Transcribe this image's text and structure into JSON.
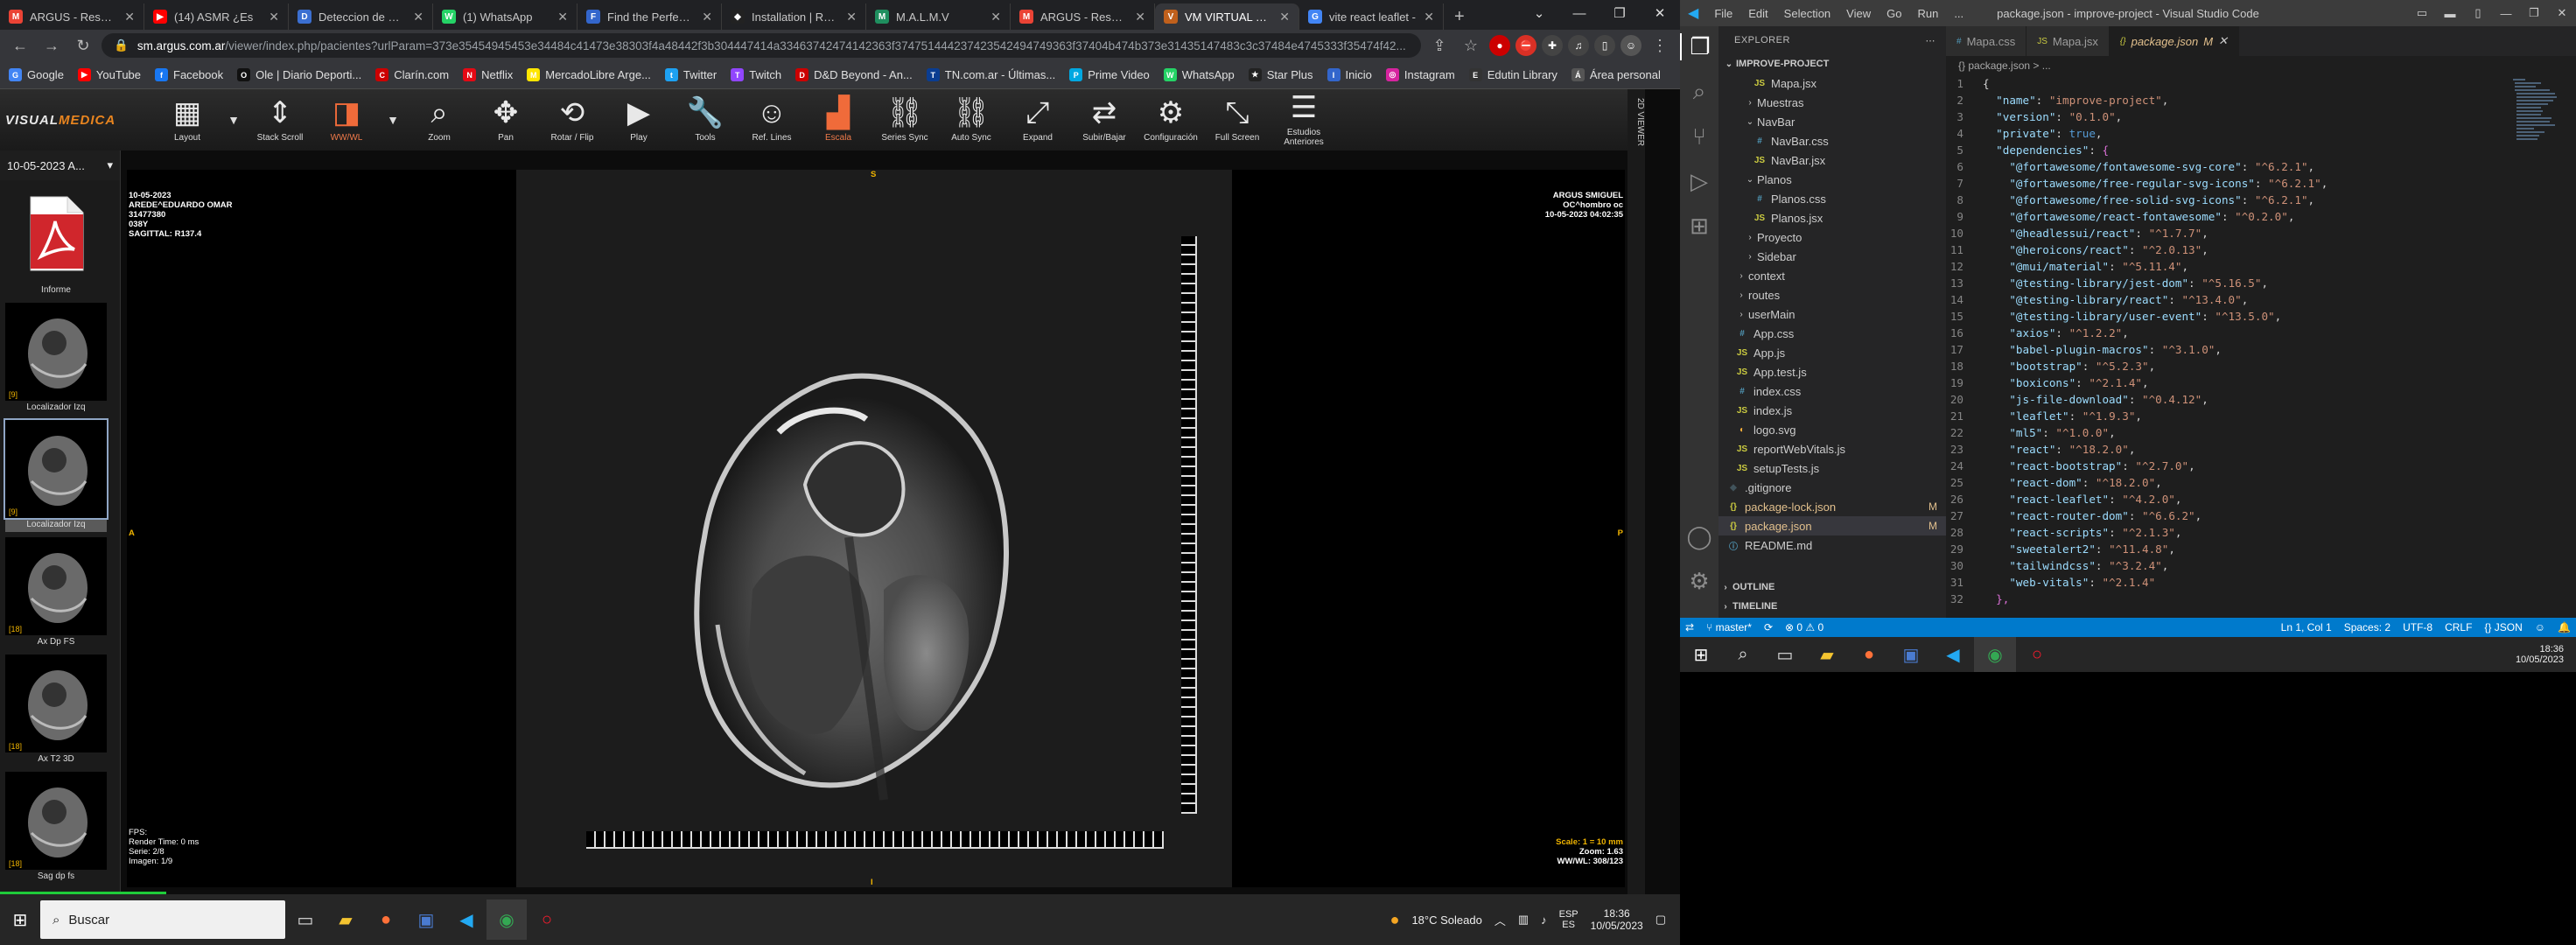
{
  "left": {
    "tabs": [
      {
        "title": "ARGUS - Resultad",
        "color": "#ea4335",
        "letter": "M"
      },
      {
        "title": "(14) ASMR ¿Es",
        "color": "#ff0000",
        "letter": "▶"
      },
      {
        "title": "Deteccion de Micr",
        "color": "#3b6fd1",
        "letter": "D"
      },
      {
        "title": "(1) WhatsApp",
        "color": "#25d366",
        "letter": "W"
      },
      {
        "title": "Find the Perfect Ic",
        "color": "#3366cc",
        "letter": "F"
      },
      {
        "title": "Installation | React",
        "color": "#222",
        "letter": "◆"
      },
      {
        "title": "M.A.L.M.V",
        "color": "#1f8f5f",
        "letter": "M"
      },
      {
        "title": "ARGUS - Resultad",
        "color": "#ea4335",
        "letter": "M"
      },
      {
        "title": "VM VIRTUAL FILM",
        "color": "#c0601c",
        "letter": "V"
      },
      {
        "title": "vite react leaflet -",
        "color": "#4285f4",
        "letter": "G"
      }
    ],
    "active_tab": 8,
    "url_host": "sm.argus.com.ar",
    "url_path": "/viewer/index.php/pacientes?urlParam=373e35454945453e34484c41473e38303f4a48442f3b304447414a33463742474142363f374751444237423542494749363f37404b474b373e31435147483c3c37484e4745333f35474f42...",
    "bookmarks": [
      {
        "label": "Google",
        "color": "#4285f4",
        "letter": "G"
      },
      {
        "label": "YouTube",
        "color": "#ff0000",
        "letter": "▶"
      },
      {
        "label": "Facebook",
        "color": "#1877f2",
        "letter": "f"
      },
      {
        "label": "Ole | Diario Deporti...",
        "color": "#111",
        "letter": "O"
      },
      {
        "label": "Clarín.com",
        "color": "#c00",
        "letter": "C"
      },
      {
        "label": "Netflix",
        "color": "#e50914",
        "letter": "N"
      },
      {
        "label": "MercadoLibre Arge...",
        "color": "#ffe600",
        "letter": "M"
      },
      {
        "label": "Twitter",
        "color": "#1da1f2",
        "letter": "t"
      },
      {
        "label": "Twitch",
        "color": "#9146ff",
        "letter": "T"
      },
      {
        "label": "D&D Beyond - An...",
        "color": "#c00",
        "letter": "D"
      },
      {
        "label": "TN.com.ar - Últimas...",
        "color": "#0a3d91",
        "letter": "T"
      },
      {
        "label": "Prime Video",
        "color": "#00a8e1",
        "letter": "P"
      },
      {
        "label": "WhatsApp",
        "color": "#25d366",
        "letter": "W"
      },
      {
        "label": "Star Plus",
        "color": "#222",
        "letter": "★"
      },
      {
        "label": "Inicio",
        "color": "#3366cc",
        "letter": "I"
      },
      {
        "label": "Instagram",
        "color": "#d6249f",
        "letter": "◎"
      },
      {
        "label": "Edutin Library",
        "color": "#333",
        "letter": "E"
      },
      {
        "label": "Área personal",
        "color": "#555",
        "letter": "Á"
      }
    ],
    "viewer": {
      "logo_a": "VISUAL",
      "logo_b": "MEDICA",
      "tools": [
        {
          "label": "Layout",
          "icon": "▦",
          "name": "layout"
        },
        {
          "label": "Stack Scroll",
          "icon": "⇕",
          "name": "stack-scroll"
        },
        {
          "label": "WW/WL",
          "icon": "◨",
          "name": "wwwl"
        },
        {
          "label": "Zoom",
          "icon": "⌕",
          "name": "zoom"
        },
        {
          "label": "Pan",
          "icon": "✥",
          "name": "pan"
        },
        {
          "label": "Rotar / Flip",
          "icon": "⟲",
          "name": "rotate-flip"
        },
        {
          "label": "Play",
          "icon": "▶",
          "name": "play"
        },
        {
          "label": "Tools",
          "icon": "🔧",
          "name": "tools"
        },
        {
          "label": "Ref. Lines",
          "icon": "☺",
          "name": "ref-lines"
        },
        {
          "label": "Escala",
          "icon": "▟",
          "name": "escala"
        },
        {
          "label": "Series Sync",
          "icon": "⛓",
          "name": "series-sync"
        },
        {
          "label": "Auto Sync",
          "icon": "⛓",
          "name": "auto-sync"
        },
        {
          "label": "Expand",
          "icon": "⤢",
          "name": "expand"
        },
        {
          "label": "Subir/Bajar",
          "icon": "⇄",
          "name": "subir-bajar"
        },
        {
          "label": "Configuración",
          "icon": "⚙",
          "name": "configuracion"
        },
        {
          "label": "Full Screen",
          "icon": "⤡",
          "name": "full-screen"
        },
        {
          "label": "Estudios Anteriores",
          "icon": "☰",
          "name": "estudios-anteriores"
        }
      ],
      "side_label": "2D VIEWER",
      "study_select": "10-05-2023 A...",
      "informe_label": "Informe",
      "thumbs": [
        {
          "label": "Localizador Izq",
          "num": "[9]"
        },
        {
          "label": "Localizador Izq",
          "num": "[9]"
        },
        {
          "label": "Ax Dp FS",
          "num": "[18]"
        },
        {
          "label": "Ax T2 3D",
          "num": "[18]"
        },
        {
          "label": "Sag dp fs",
          "num": "[18]"
        }
      ],
      "ov_tl": [
        "10-05-2023",
        "AREDE^EDUARDO OMAR",
        "31477380",
        "038Y",
        "SAGITTAL: R137.4"
      ],
      "ov_tr": [
        "ARGUS SMIGUEL",
        "OC^hombro oc",
        "10-05-2023 04:02:35"
      ],
      "ov_bl": [
        "FPS:",
        "Render Time: 0 ms",
        "Serie: 2/8",
        "Imagen: 1/9"
      ],
      "ov_br": [
        "Scale: 1 = 10 mm",
        "Zoom: 1.63",
        "WW/WL: 308/123"
      ],
      "orient_top": "S",
      "orient_left": "A",
      "orient_right": "P",
      "orient_bottom": "I"
    },
    "taskbar": {
      "search": "Buscar",
      "weather": "18°C  Soleado",
      "lang_a": "ESP",
      "lang_b": "ES",
      "time": "18:36",
      "date": "10/05/2023"
    }
  },
  "right": {
    "menu": [
      "File",
      "Edit",
      "Selection",
      "View",
      "Go",
      "Run",
      "..."
    ],
    "title": "package.json - improve-project - Visual Studio Code",
    "explorer_header": "EXPLORER",
    "project": "IMPROVE-PROJECT",
    "tree": [
      {
        "label": "Mapa.jsx",
        "indent": 3,
        "type": "jsx"
      },
      {
        "label": "Muestras",
        "indent": 2,
        "type": "folder",
        "open": false
      },
      {
        "label": "NavBar",
        "indent": 2,
        "type": "folder",
        "open": true
      },
      {
        "label": "NavBar.css",
        "indent": 3,
        "type": "css"
      },
      {
        "label": "NavBar.jsx",
        "indent": 3,
        "type": "jsx"
      },
      {
        "label": "Planos",
        "indent": 2,
        "type": "folder",
        "open": true
      },
      {
        "label": "Planos.css",
        "indent": 3,
        "type": "css"
      },
      {
        "label": "Planos.jsx",
        "indent": 3,
        "type": "jsx"
      },
      {
        "label": "Proyecto",
        "indent": 2,
        "type": "folder",
        "open": false
      },
      {
        "label": "Sidebar",
        "indent": 2,
        "type": "folder",
        "open": false
      },
      {
        "label": "context",
        "indent": 1,
        "type": "folder",
        "open": false
      },
      {
        "label": "routes",
        "indent": 1,
        "type": "folder",
        "open": false
      },
      {
        "label": "userMain",
        "indent": 1,
        "type": "folder",
        "open": false
      },
      {
        "label": "App.css",
        "indent": 1,
        "type": "css"
      },
      {
        "label": "App.js",
        "indent": 1,
        "type": "js"
      },
      {
        "label": "App.test.js",
        "indent": 1,
        "type": "js"
      },
      {
        "label": "index.css",
        "indent": 1,
        "type": "css"
      },
      {
        "label": "index.js",
        "indent": 1,
        "type": "js"
      },
      {
        "label": "logo.svg",
        "indent": 1,
        "type": "svg"
      },
      {
        "label": "reportWebVitals.js",
        "indent": 1,
        "type": "js"
      },
      {
        "label": "setupTests.js",
        "indent": 1,
        "type": "js"
      },
      {
        "label": ".gitignore",
        "indent": 0,
        "type": "git"
      },
      {
        "label": "package-lock.json",
        "indent": 0,
        "type": "json",
        "mod": "M"
      },
      {
        "label": "package.json",
        "indent": 0,
        "type": "json",
        "mod": "M",
        "sel": true
      },
      {
        "label": "README.md",
        "indent": 0,
        "type": "md"
      }
    ],
    "outline": "OUTLINE",
    "timeline": "TIMELINE",
    "tabs": [
      {
        "label": "Mapa.css",
        "type": "css"
      },
      {
        "label": "Mapa.jsx",
        "type": "jsx"
      },
      {
        "label": "package.json",
        "type": "json",
        "active": true,
        "mod": "M"
      }
    ],
    "breadcrumb": "{} package.json > ...",
    "code": [
      [
        [
          "p",
          "{"
        ]
      ],
      [
        [
          "k",
          "  \"name\""
        ],
        [
          "p",
          ": "
        ],
        [
          "s",
          "\"improve-project\""
        ],
        [
          "p",
          ","
        ]
      ],
      [
        [
          "k",
          "  \"version\""
        ],
        [
          "p",
          ": "
        ],
        [
          "s",
          "\"0.1.0\""
        ],
        [
          "p",
          ","
        ]
      ],
      [
        [
          "k",
          "  \"private\""
        ],
        [
          "p",
          ": "
        ],
        [
          "b",
          "true"
        ],
        [
          "p",
          ","
        ]
      ],
      [
        [
          "k",
          "  \"dependencies\""
        ],
        [
          "p",
          ": "
        ],
        [
          "br2",
          "{"
        ]
      ],
      [
        [
          "k",
          "    \"@fortawesome/fontawesome-svg-core\""
        ],
        [
          "p",
          ": "
        ],
        [
          "s",
          "\"^6.2.1\""
        ],
        [
          "p",
          ","
        ]
      ],
      [
        [
          "k",
          "    \"@fortawesome/free-regular-svg-icons\""
        ],
        [
          "p",
          ": "
        ],
        [
          "s",
          "\"^6.2.1\""
        ],
        [
          "p",
          ","
        ]
      ],
      [
        [
          "k",
          "    \"@fortawesome/free-solid-svg-icons\""
        ],
        [
          "p",
          ": "
        ],
        [
          "s",
          "\"^6.2.1\""
        ],
        [
          "p",
          ","
        ]
      ],
      [
        [
          "k",
          "    \"@fortawesome/react-fontawesome\""
        ],
        [
          "p",
          ": "
        ],
        [
          "s",
          "\"^0.2.0\""
        ],
        [
          "p",
          ","
        ]
      ],
      [
        [
          "k",
          "    \"@headlessui/react\""
        ],
        [
          "p",
          ": "
        ],
        [
          "s",
          "\"^1.7.7\""
        ],
        [
          "p",
          ","
        ]
      ],
      [
        [
          "k",
          "    \"@heroicons/react\""
        ],
        [
          "p",
          ": "
        ],
        [
          "s",
          "\"^2.0.13\""
        ],
        [
          "p",
          ","
        ]
      ],
      [
        [
          "k",
          "    \"@mui/material\""
        ],
        [
          "p",
          ": "
        ],
        [
          "s",
          "\"^5.11.4\""
        ],
        [
          "p",
          ","
        ]
      ],
      [
        [
          "k",
          "    \"@testing-library/jest-dom\""
        ],
        [
          "p",
          ": "
        ],
        [
          "s",
          "\"^5.16.5\""
        ],
        [
          "p",
          ","
        ]
      ],
      [
        [
          "k",
          "    \"@testing-library/react\""
        ],
        [
          "p",
          ": "
        ],
        [
          "s",
          "\"^13.4.0\""
        ],
        [
          "p",
          ","
        ]
      ],
      [
        [
          "k",
          "    \"@testing-library/user-event\""
        ],
        [
          "p",
          ": "
        ],
        [
          "s",
          "\"^13.5.0\""
        ],
        [
          "p",
          ","
        ]
      ],
      [
        [
          "k",
          "    \"axios\""
        ],
        [
          "p",
          ": "
        ],
        [
          "s",
          "\"^1.2.2\""
        ],
        [
          "p",
          ","
        ]
      ],
      [
        [
          "k",
          "    \"babel-plugin-macros\""
        ],
        [
          "p",
          ": "
        ],
        [
          "s",
          "\"^3.1.0\""
        ],
        [
          "p",
          ","
        ]
      ],
      [
        [
          "k",
          "    \"bootstrap\""
        ],
        [
          "p",
          ": "
        ],
        [
          "s",
          "\"^5.2.3\""
        ],
        [
          "p",
          ","
        ]
      ],
      [
        [
          "k",
          "    \"boxicons\""
        ],
        [
          "p",
          ": "
        ],
        [
          "s",
          "\"^2.1.4\""
        ],
        [
          "p",
          ","
        ]
      ],
      [
        [
          "k",
          "    \"js-file-download\""
        ],
        [
          "p",
          ": "
        ],
        [
          "s",
          "\"^0.4.12\""
        ],
        [
          "p",
          ","
        ]
      ],
      [
        [
          "k",
          "    \"leaflet\""
        ],
        [
          "p",
          ": "
        ],
        [
          "s",
          "\"^1.9.3\""
        ],
        [
          "p",
          ","
        ]
      ],
      [
        [
          "k",
          "    \"ml5\""
        ],
        [
          "p",
          ": "
        ],
        [
          "s",
          "\"^1.0.0\""
        ],
        [
          "p",
          ","
        ]
      ],
      [
        [
          "k",
          "    \"react\""
        ],
        [
          "p",
          ": "
        ],
        [
          "s",
          "\"^18.2.0\""
        ],
        [
          "p",
          ","
        ]
      ],
      [
        [
          "k",
          "    \"react-bootstrap\""
        ],
        [
          "p",
          ": "
        ],
        [
          "s",
          "\"^2.7.0\""
        ],
        [
          "p",
          ","
        ]
      ],
      [
        [
          "k",
          "    \"react-dom\""
        ],
        [
          "p",
          ": "
        ],
        [
          "s",
          "\"^18.2.0\""
        ],
        [
          "p",
          ","
        ]
      ],
      [
        [
          "k",
          "    \"react-leaflet\""
        ],
        [
          "p",
          ": "
        ],
        [
          "s",
          "\"^4.2.0\""
        ],
        [
          "p",
          ","
        ]
      ],
      [
        [
          "k",
          "    \"react-router-dom\""
        ],
        [
          "p",
          ": "
        ],
        [
          "s",
          "\"^6.6.2\""
        ],
        [
          "p",
          ","
        ]
      ],
      [
        [
          "k",
          "    \"react-scripts\""
        ],
        [
          "p",
          ": "
        ],
        [
          "s",
          "\"^2.1.3\""
        ],
        [
          "p",
          ","
        ]
      ],
      [
        [
          "k",
          "    \"sweetalert2\""
        ],
        [
          "p",
          ": "
        ],
        [
          "s",
          "\"^11.4.8\""
        ],
        [
          "p",
          ","
        ]
      ],
      [
        [
          "k",
          "    \"tailwindcss\""
        ],
        [
          "p",
          ": "
        ],
        [
          "s",
          "\"^3.2.4\""
        ],
        [
          "p",
          ","
        ]
      ],
      [
        [
          "k",
          "    \"web-vitals\""
        ],
        [
          "p",
          ": "
        ],
        [
          "s",
          "\"^2.1.4\""
        ]
      ],
      [
        [
          "br2",
          "  },"
        ]
      ]
    ],
    "status": {
      "branch": "master*",
      "sync": "⟳",
      "problems": "⊗ 0 ⚠ 0",
      "pos": "Ln 1, Col 1",
      "spaces": "Spaces: 2",
      "enc": "UTF-8",
      "eol": "CRLF",
      "lang": "{} JSON"
    },
    "clock_time": "18:36",
    "clock_date": "10/05/2023"
  }
}
